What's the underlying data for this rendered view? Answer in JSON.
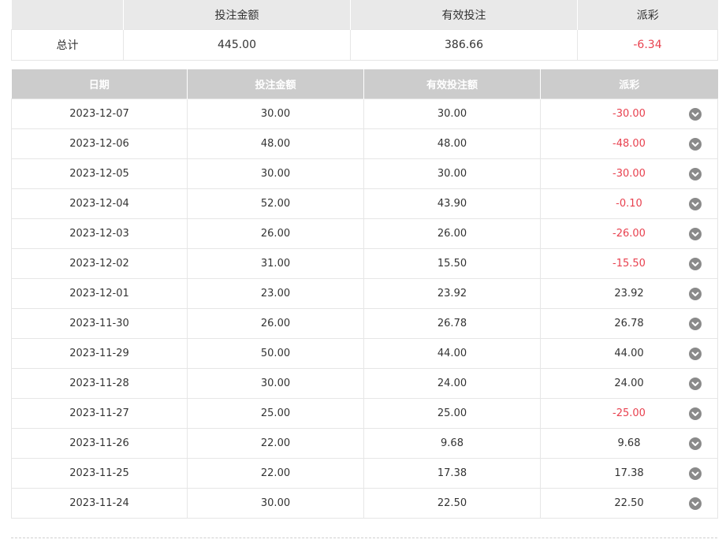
{
  "summary": {
    "headers": [
      "",
      "投注金额",
      "有效投注",
      "派彩"
    ],
    "row": {
      "label": "总计",
      "bet_amount": "445.00",
      "valid_bet": "386.66",
      "payout": "-6.34",
      "payout_negative": true
    }
  },
  "daily": {
    "headers": [
      "日期",
      "投注金额",
      "有效投注额",
      "派彩"
    ],
    "rows": [
      {
        "date": "2023-12-07",
        "bet": "30.00",
        "valid": "30.00",
        "payout": "-30.00",
        "neg": true
      },
      {
        "date": "2023-12-06",
        "bet": "48.00",
        "valid": "48.00",
        "payout": "-48.00",
        "neg": true
      },
      {
        "date": "2023-12-05",
        "bet": "30.00",
        "valid": "30.00",
        "payout": "-30.00",
        "neg": true
      },
      {
        "date": "2023-12-04",
        "bet": "52.00",
        "valid": "43.90",
        "payout": "-0.10",
        "neg": true
      },
      {
        "date": "2023-12-03",
        "bet": "26.00",
        "valid": "26.00",
        "payout": "-26.00",
        "neg": true
      },
      {
        "date": "2023-12-02",
        "bet": "31.00",
        "valid": "15.50",
        "payout": "-15.50",
        "neg": true
      },
      {
        "date": "2023-12-01",
        "bet": "23.00",
        "valid": "23.92",
        "payout": "23.92",
        "neg": false
      },
      {
        "date": "2023-11-30",
        "bet": "26.00",
        "valid": "26.78",
        "payout": "26.78",
        "neg": false
      },
      {
        "date": "2023-11-29",
        "bet": "50.00",
        "valid": "44.00",
        "payout": "44.00",
        "neg": false
      },
      {
        "date": "2023-11-28",
        "bet": "30.00",
        "valid": "24.00",
        "payout": "24.00",
        "neg": false
      },
      {
        "date": "2023-11-27",
        "bet": "25.00",
        "valid": "25.00",
        "payout": "-25.00",
        "neg": true
      },
      {
        "date": "2023-11-26",
        "bet": "22.00",
        "valid": "9.68",
        "payout": "9.68",
        "neg": false
      },
      {
        "date": "2023-11-25",
        "bet": "22.00",
        "valid": "17.38",
        "payout": "17.38",
        "neg": false
      },
      {
        "date": "2023-11-24",
        "bet": "30.00",
        "valid": "22.50",
        "payout": "22.50",
        "neg": false
      }
    ]
  },
  "colors": {
    "negative": "#e8414f",
    "header_bg": "#cccccc",
    "summary_header_bg": "#e9e9e9",
    "icon": "#8a8a8a"
  },
  "icons": {
    "row_expand": "chevron-down-circle-icon"
  }
}
